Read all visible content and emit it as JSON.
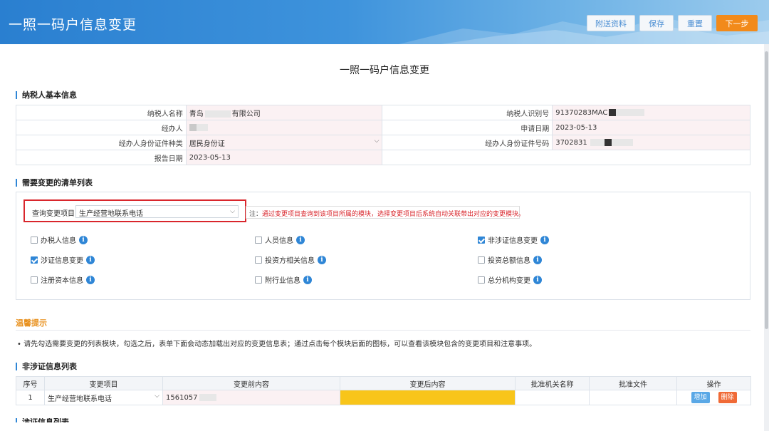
{
  "header": {
    "title": "一照一码户信息变更",
    "buttons": {
      "attach": "附送资料",
      "save": "保存",
      "reset": "重置",
      "next": "下一步"
    }
  },
  "page": {
    "title": "一照一码户信息变更"
  },
  "basic_info": {
    "section_title": "纳税人基本信息",
    "taxpayer_name_label": "纳税人名称",
    "taxpayer_name_prefix": "青岛",
    "taxpayer_name_suffix": "有限公司",
    "taxpayer_id_label": "纳税人识别号",
    "taxpayer_id": "91370283MAC",
    "agent_label": "经办人",
    "apply_date_label": "申请日期",
    "apply_date": "2023-05-13",
    "id_type_label": "经办人身份证件种类",
    "id_type_value": "居民身份证",
    "id_number_label": "经办人身份证件号码",
    "id_number": "3702831",
    "report_date_label": "报告日期",
    "report_date": "2023-05-13"
  },
  "change_list": {
    "section_title": "需要变更的清单列表",
    "query_label": "查询变更项目：",
    "query_value": "生产经营地联系电话",
    "note_prefix": "注：",
    "note_text": "通过变更项目查询到该项目所属的模块，选择变更项目后系统自动关联带出对应的变更模块。",
    "checkboxes": [
      {
        "label": "办税人信息",
        "checked": false
      },
      {
        "label": "人员信息",
        "checked": false
      },
      {
        "label": "非涉证信息变更",
        "checked": true
      },
      {
        "label": "涉证信息变更",
        "checked": true
      },
      {
        "label": "投资方相关信息",
        "checked": false
      },
      {
        "label": "投资总额信息",
        "checked": false
      },
      {
        "label": "注册资本信息",
        "checked": false
      },
      {
        "label": "附行业信息",
        "checked": false
      },
      {
        "label": "总分机构变更",
        "checked": false
      }
    ]
  },
  "tips": {
    "title": "温馨提示",
    "text": "• 请先勾选需要变更的列表模块，勾选之后，表单下面会动态加载出对应的变更信息表；通过点击每个模块后面的图标，可以查看该模块包含的变更项目和注意事项。"
  },
  "non_license_table": {
    "section_title": "非涉证信息列表",
    "headers": [
      "序号",
      "变更项目",
      "变更前内容",
      "变更后内容",
      "批准机关名称",
      "批准文件",
      "操作"
    ],
    "rows": [
      {
        "index": "1",
        "item": "生产经营地联系电话",
        "before": "1561057",
        "after": "",
        "authority": "",
        "document": ""
      }
    ],
    "add_label": "增加",
    "delete_label": "删除"
  },
  "license_table": {
    "section_title": "涉证信息列表"
  },
  "colors": {
    "accent": "#2f86d6",
    "next_button": "#f28a1a",
    "highlight": "#f8c51a",
    "alert_red": "#d9262c",
    "tip_orange": "#e8901c"
  }
}
